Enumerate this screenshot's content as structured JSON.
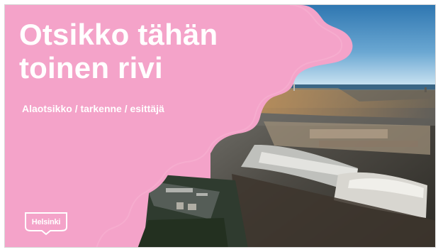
{
  "slide": {
    "title_line_1": "Otsikko tähän",
    "title_line_2": "toinen rivi",
    "subtitle": "Alaotsikko / tarkenne / esittäjä",
    "logo_text": "Helsinki",
    "background_color": "#f4a3c9",
    "text_color": "#ffffff"
  }
}
